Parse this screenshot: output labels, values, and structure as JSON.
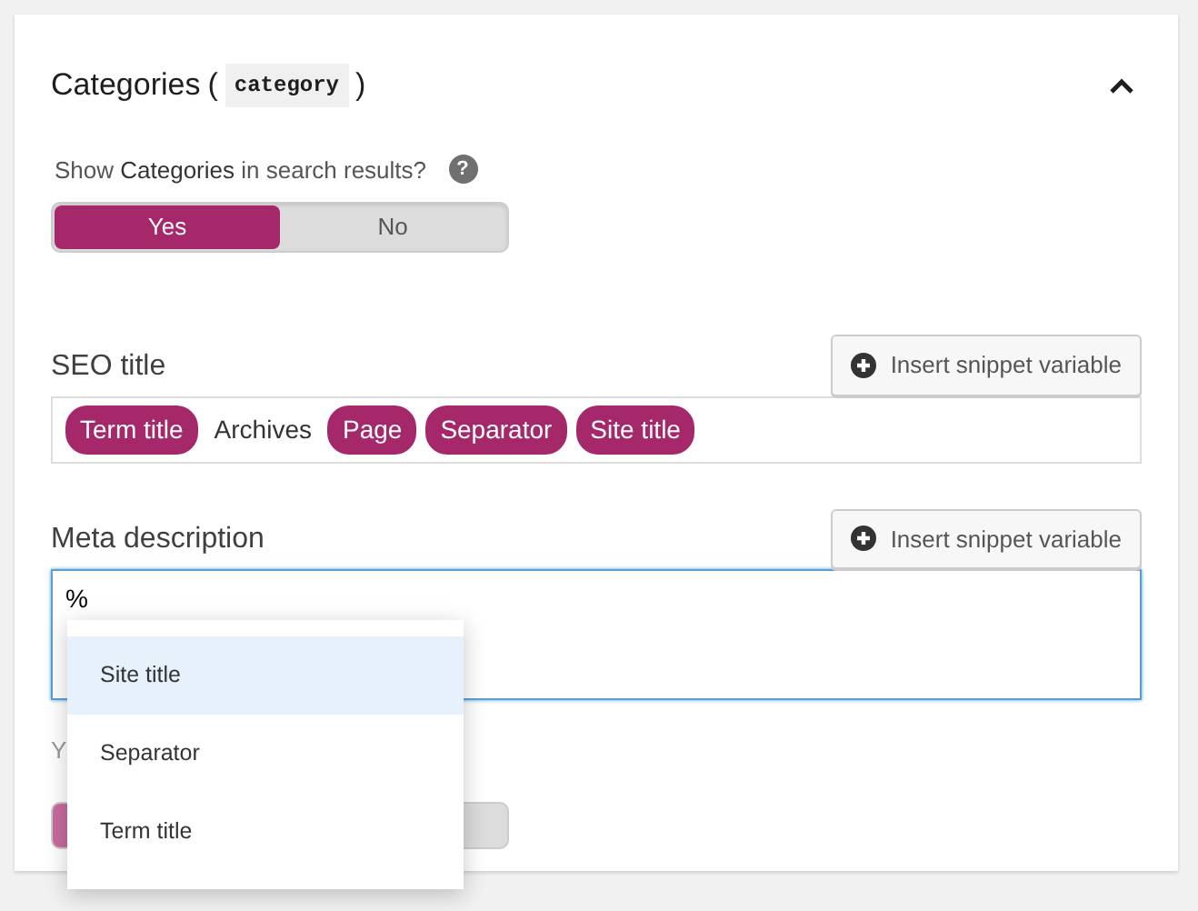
{
  "panel": {
    "title": "Categories",
    "open_paren": "(",
    "code": "category",
    "close_paren": ")",
    "expanded": true
  },
  "show_setting": {
    "question": "Show **Categories** in search results?",
    "help": "?",
    "options": [
      {
        "label": "Yes",
        "selected": true
      },
      {
        "label": "No",
        "selected": false
      }
    ]
  },
  "seo_title": {
    "label": "SEO title",
    "button": "Insert snippet variable",
    "tokens": [
      {
        "kind": "variable",
        "text": "Term title"
      },
      {
        "kind": "text",
        "text": "Archives"
      },
      {
        "kind": "variable",
        "text": "Page"
      },
      {
        "kind": "variable",
        "text": "Separator"
      },
      {
        "kind": "variable",
        "text": "Site title"
      }
    ]
  },
  "meta_description": {
    "label": "Meta description",
    "button": "Insert snippet variable",
    "value": "%",
    "focused": true
  },
  "hidden_setting": {
    "label": "Y",
    "options": [
      {
        "selected": true
      },
      {
        "selected": false
      }
    ]
  },
  "suggestions": [
    {
      "label": "Site title",
      "selected": true
    },
    {
      "label": "Separator",
      "selected": false
    },
    {
      "label": "Term title",
      "selected": false
    }
  ]
}
